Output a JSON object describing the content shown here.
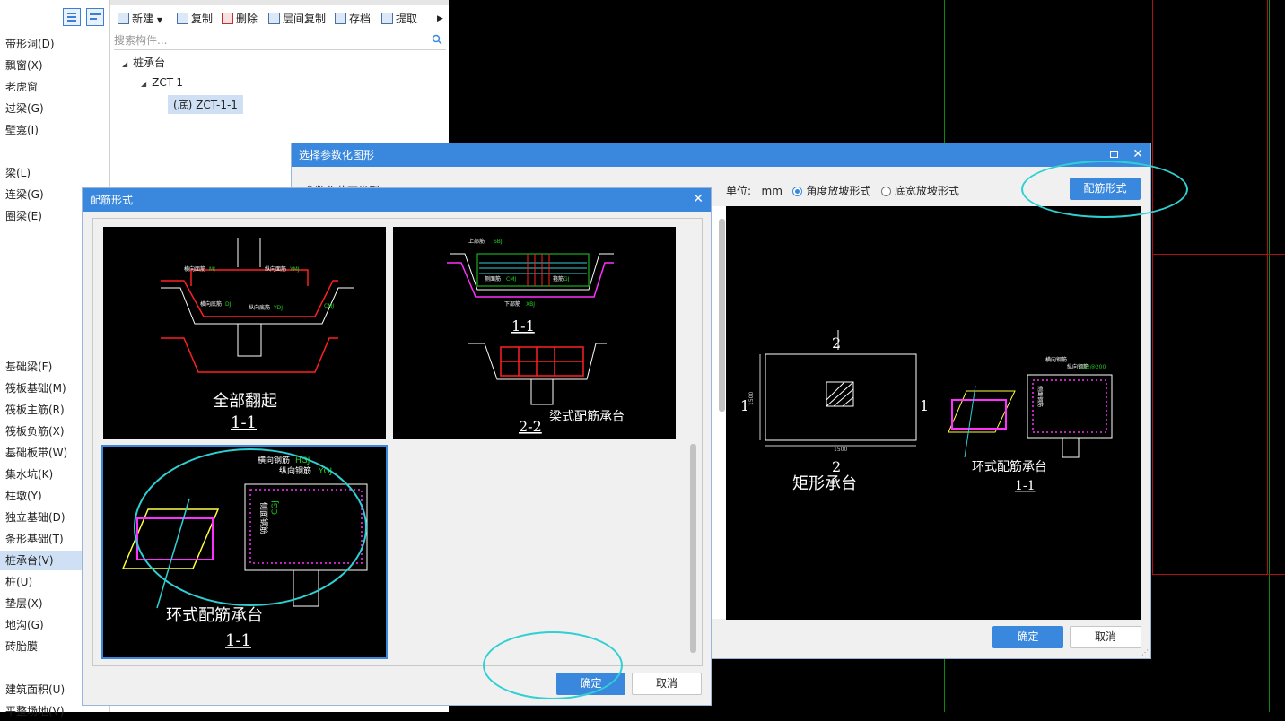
{
  "categories": [
    {
      "label": "带形洞(D)"
    },
    {
      "label": "飘窗(X)"
    },
    {
      "label": "老虎窗"
    },
    {
      "label": "过梁(G)"
    },
    {
      "label": "壁龛(I)"
    },
    {
      "label": "梁(L)"
    },
    {
      "label": "连梁(G)"
    },
    {
      "label": "圈梁(E)"
    },
    {
      "label": "基础梁(F)"
    },
    {
      "label": "筏板基础(M)"
    },
    {
      "label": "筏板主筋(R)"
    },
    {
      "label": "筏板负筋(X)"
    },
    {
      "label": "基础板带(W)"
    },
    {
      "label": "集水坑(K)"
    },
    {
      "label": "柱墩(Y)"
    },
    {
      "label": "独立基础(D)"
    },
    {
      "label": "条形基础(T)"
    },
    {
      "label": "桩承台(V)"
    },
    {
      "label": "桩(U)"
    },
    {
      "label": "垫层(X)"
    },
    {
      "label": "地沟(G)"
    },
    {
      "label": "砖胎膜"
    },
    {
      "label": "建筑面积(U)"
    },
    {
      "label": "平整场地(V)"
    }
  ],
  "toolbar": {
    "new": "新建",
    "copy": "复制",
    "delete": "删除",
    "floor_copy": "层间复制",
    "archive": "存档",
    "extract": "提取"
  },
  "search": {
    "placeholder": "搜索构件..."
  },
  "tree": {
    "root": "桩承台",
    "child": "ZCT-1",
    "leaf": "(底) ZCT-1-1"
  },
  "dlg_param": {
    "title": "选择参数化图形",
    "section_label": "参数化截面类型",
    "unit_label": "单位:",
    "unit_value": "mm",
    "radio1": "角度放坡形式",
    "radio2": "底宽放坡形式",
    "rebar_button": "配筋形式",
    "ok": "确定",
    "cancel": "取消",
    "preview": {
      "section_mark": "2",
      "side_mark": "1",
      "dim_h": "1500",
      "dim_w": "1500",
      "caption_rect": "矩形承台",
      "caption_ring": "环式配筋承台",
      "sub_caption": "1-1",
      "label_h": "横向钢筋",
      "label_v": "纵向钢筋",
      "label_spec": "C12@200",
      "label_side": "侧面钢筋"
    }
  },
  "dlg_rebar": {
    "title": "配筋形式",
    "ok": "确定",
    "cancel": "取消",
    "thumbs": [
      {
        "caption": "全部翻起",
        "sub": "1-1",
        "labels": [
          "横向面筋",
          "MJ",
          "纵向面筋",
          "YMJ",
          "横向底筋",
          "DJ",
          "纵向底筋",
          "YDJ",
          "CMJ"
        ]
      },
      {
        "caption": "梁式配筋承台",
        "sub1": "1-1",
        "sub2": "2-2",
        "labels": [
          "上部筋",
          "SBJ",
          "侧面筋",
          "CMJ",
          "下部筋",
          "XBJ",
          "箍筋",
          "GJ"
        ]
      },
      {
        "caption": "环式配筋承台",
        "sub": "1-1",
        "labels": [
          "横向钢筋",
          "HGJ",
          "纵向钢筋",
          "YGJ",
          "侧面钢筋",
          "CGJ"
        ]
      }
    ]
  },
  "colors": {
    "accent": "#3a88dd",
    "highlight": "#2fd0d3",
    "cad_red": "#ff2020",
    "cad_green": "#20d020",
    "cad_magenta": "#ff30ff",
    "cad_yellow": "#ffff40"
  }
}
